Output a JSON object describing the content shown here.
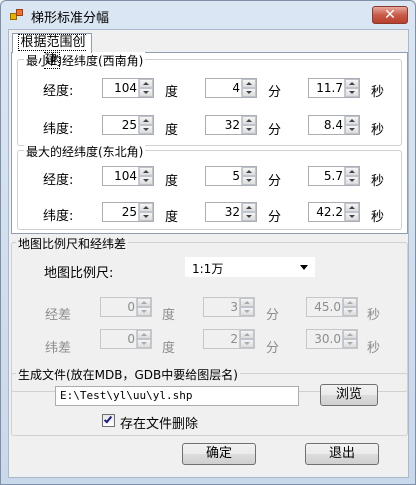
{
  "window": {
    "title": "梯形标准分幅",
    "close_label": "✕"
  },
  "tab": {
    "label": "根据范围创建"
  },
  "min_group": {
    "title": "最小的经纬度(西南角)",
    "lon_label": "经度:",
    "lat_label": "纬度:",
    "lon": {
      "deg": "104",
      "min": "4",
      "sec": "11.7"
    },
    "lat": {
      "deg": "25",
      "min": "32",
      "sec": "8.4"
    }
  },
  "max_group": {
    "title": "最大的经纬度(东北角)",
    "lon_label": "经度:",
    "lat_label": "纬度:",
    "lon": {
      "deg": "104",
      "min": "5",
      "sec": "5.7"
    },
    "lat": {
      "deg": "25",
      "min": "32",
      "sec": "42.2"
    }
  },
  "units": {
    "deg": "度",
    "min": "分",
    "sec": "秒"
  },
  "scale_group": {
    "title": "地图比例尺和经纬差",
    "scale_label": "地图比例尺:",
    "scale_value": "1:1万",
    "lon_diff_label": "经差",
    "lat_diff_label": "纬差",
    "lon_diff": {
      "deg": "0",
      "min": "3",
      "sec": "45.0"
    },
    "lat_diff": {
      "deg": "0",
      "min": "2",
      "sec": "30.0"
    }
  },
  "output_group": {
    "title": "生成文件(放在MDB，GDB中要给图层名)",
    "path": "E:\\Test\\yl\\uu\\yl.shp",
    "browse_label": "浏览",
    "delete_label": "存在文件删除",
    "delete_checked": true
  },
  "buttons": {
    "ok_label": "确定",
    "exit_label": "退出"
  }
}
